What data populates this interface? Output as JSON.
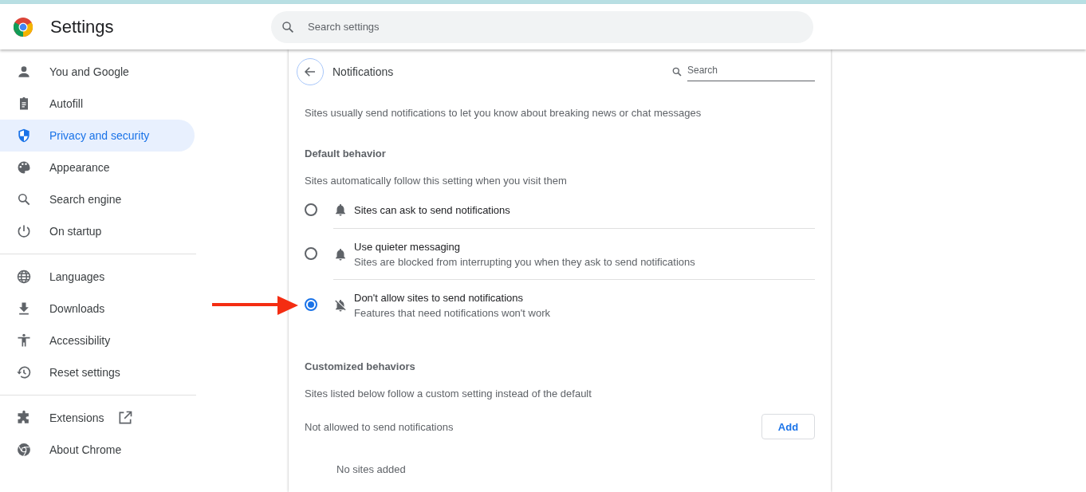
{
  "header": {
    "title": "Settings",
    "search": {
      "placeholder": "Search settings"
    }
  },
  "sidebar": {
    "groups": [
      {
        "items": [
          {
            "label": "You and Google",
            "selected": false
          },
          {
            "label": "Autofill",
            "selected": false
          },
          {
            "label": "Privacy and security",
            "selected": true
          },
          {
            "label": "Appearance",
            "selected": false
          },
          {
            "label": "Search engine",
            "selected": false
          },
          {
            "label": "On startup",
            "selected": false
          }
        ]
      },
      {
        "items": [
          {
            "label": "Languages",
            "selected": false
          },
          {
            "label": "Downloads",
            "selected": false
          },
          {
            "label": "Accessibility",
            "selected": false
          },
          {
            "label": "Reset settings",
            "selected": false
          }
        ]
      },
      {
        "items": [
          {
            "label": "Extensions",
            "selected": false
          },
          {
            "label": "About Chrome",
            "selected": false
          }
        ]
      }
    ]
  },
  "page": {
    "title": "Notifications",
    "search": {
      "placeholder": "Search"
    },
    "intro": "Sites usually send notifications to let you know about breaking news or chat messages",
    "default_behavior": {
      "heading": "Default behavior",
      "description": "Sites automatically follow this setting when you visit them",
      "options": [
        {
          "label": "Sites can ask to send notifications",
          "selected": false
        },
        {
          "label": "Use quieter messaging",
          "description": "Sites are blocked from interrupting you when they ask to send notifications",
          "selected": false
        },
        {
          "label": "Don't allow sites to send notifications",
          "description": "Features that need notifications won't work",
          "selected": true
        }
      ]
    },
    "customized_behaviors": {
      "heading": "Customized behaviors",
      "description": "Sites listed below follow a custom setting instead of the default",
      "lists": [
        {
          "label": "Not allowed to send notifications",
          "button": "Add",
          "empty": "No sites added"
        }
      ]
    }
  }
}
